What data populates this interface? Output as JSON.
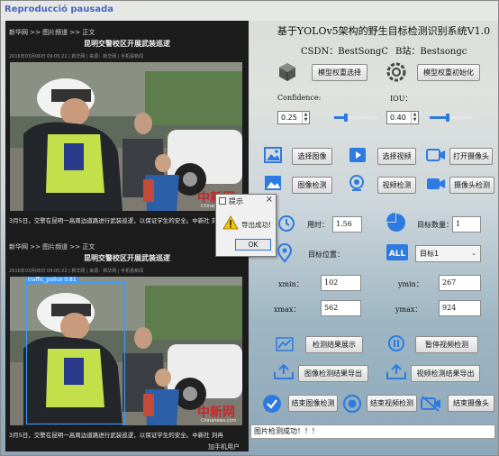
{
  "window": {
    "title": "Reproducció pausada"
  },
  "top_page": {
    "nav": "新华网 >> 图片频道 >> 正文",
    "title": "昆明交警校区开展武装巡逻",
    "meta": "2016年03月06日 09:05:22 | 新华网 | 来源：新华网 | 手机看新闻",
    "caption": "3月5日，交警在昆明一高周边道路进行武装巡逻，以保证学生的安全。中新社 刘冉阳摄",
    "watermark": "中新网",
    "watermark_sub": "Chinanews.com"
  },
  "bottom_page": {
    "nav": "新华网 >> 图片频道 >> 正文",
    "title": "昆明交警校区开展武装巡逻",
    "meta": "2016年03月06日 09:05:22 | 新华网 | 来源：新华网 | 手机看新闻",
    "detection_label": "traffic_police 0.81",
    "caption": "3月5日，交警在昆明一高周边道路进行武装巡逻，以保证学生的安全。中新社 刘冉",
    "watermark": "中新网",
    "watermark_sub": "Chinanews.com",
    "footer": "加手机用户"
  },
  "dialog": {
    "title": "提示",
    "message": "导出成功!",
    "ok": "OK",
    "close": "×"
  },
  "header": {
    "title": "基于YOLOv5架构的野生目标检测识别系统V1.0",
    "csdn": "CSDN：BestSongC",
    "bilibili": "B站：Bestsongc"
  },
  "model": {
    "select_btn": "模型权重选择",
    "init_btn": "模型权重初始化"
  },
  "confidence": {
    "label": "Confidence:",
    "value": "0.25",
    "slider_fraction": 0.25
  },
  "iou": {
    "label": "IOU：",
    "value": "0.40",
    "slider_fraction": 0.4
  },
  "buttons": {
    "select_image": "选择图像",
    "select_video": "选择视频",
    "open_camera": "打开摄像头",
    "image_detect": "图像检测",
    "video_detect": "视频检测",
    "camera_detect": "摄像头检测",
    "show_results": "检测结果展示",
    "pause_video": "暂停视频检测",
    "export_image": "图像检测结果导出",
    "export_video": "视频检测结果导出",
    "end_image": "结束图像检测",
    "end_video": "结束视频检测",
    "end_camera": "结束摄像头"
  },
  "stats": {
    "time_label": "用时：",
    "time_value": "1.56",
    "count_label": "目标数量：",
    "count_value": "1",
    "position_label": "目标位置：",
    "target_select": "目标1"
  },
  "coords": {
    "xmin_label": "xmin：",
    "xmin": "102",
    "ymin_label": "ymin：",
    "ymin": "267",
    "xmax_label": "xmax：",
    "xmax": "562",
    "ymax_label": "ymax：",
    "ymax": "924"
  },
  "status": "图片检测成功！！！",
  "colors": {
    "accent": "#2d7be0",
    "watermark": "#c6282c"
  }
}
